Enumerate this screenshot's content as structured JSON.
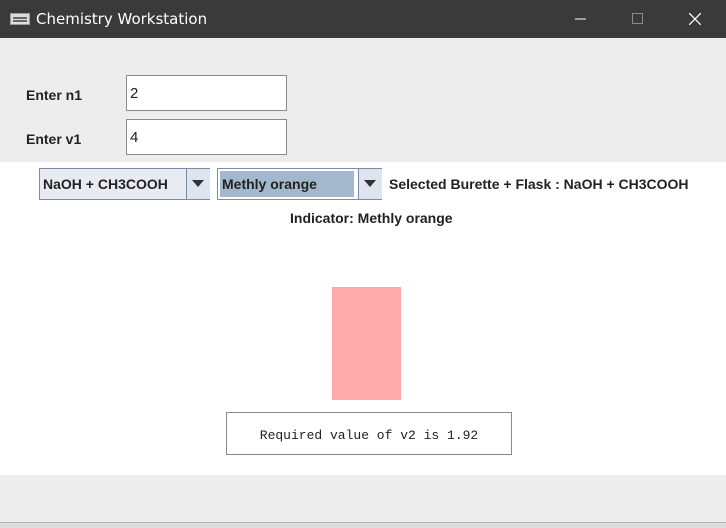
{
  "window": {
    "title": "Chemistry Workstation",
    "icons": {
      "app": "app-icon",
      "minimize": "minimize-icon",
      "maximize": "maximize-icon",
      "close": "close-icon"
    }
  },
  "inputs": {
    "n1": {
      "label": "Enter n1",
      "value": "2"
    },
    "v1": {
      "label": "Enter v1",
      "value": "4"
    }
  },
  "controls": {
    "reaction_select": {
      "selected": "NaOH + CH3COOH"
    },
    "indicator_select": {
      "selected": "Methly orange"
    }
  },
  "status": {
    "selected_text": "Selected Burette + Flask : NaOH + CH3COOH",
    "indicator_text": "Indicator: Methly orange"
  },
  "flask": {
    "color": "#ffaaaa"
  },
  "result": {
    "text": "Required value of v2 is 1.92"
  },
  "colors": {
    "titlebar": "#3a3a3a",
    "panel": "#ededed",
    "selection": "#a3b8cc"
  }
}
